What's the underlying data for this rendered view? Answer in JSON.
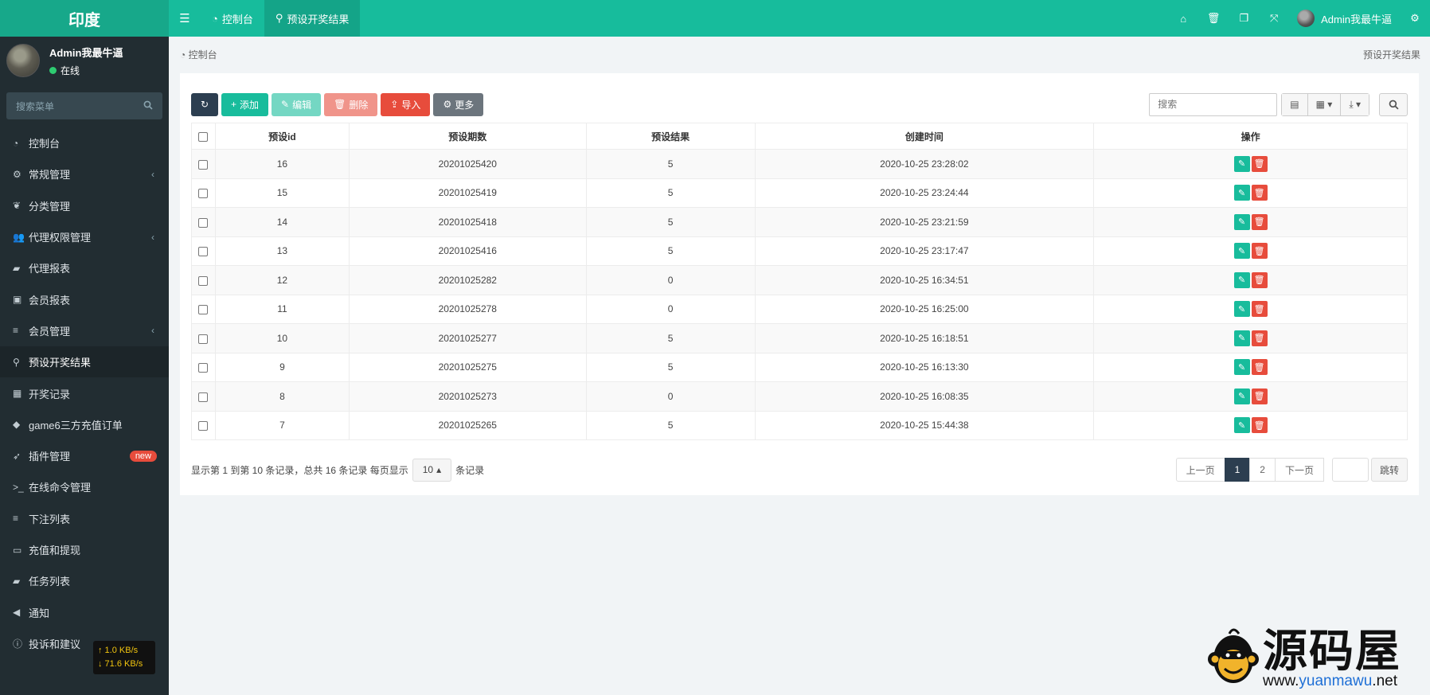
{
  "sidebar": {
    "logo": "印度",
    "user_name": "Admin我最牛逼",
    "user_status": "在线",
    "search_placeholder": "搜索菜单",
    "items": [
      {
        "label": "控制台",
        "icon": "dashboard-icon"
      },
      {
        "label": "常规管理",
        "icon": "cogs-icon",
        "has_arrow": true
      },
      {
        "label": "分类管理",
        "icon": "leaf-icon"
      },
      {
        "label": "代理权限管理",
        "icon": "group-icon",
        "has_arrow": true
      },
      {
        "label": "代理报表",
        "icon": "book-icon"
      },
      {
        "label": "会员报表",
        "icon": "contact-icon"
      },
      {
        "label": "会员管理",
        "icon": "list-icon",
        "has_arrow": true
      },
      {
        "label": "预设开奖结果",
        "icon": "magic-icon",
        "active": true
      },
      {
        "label": "开奖记录",
        "icon": "calendar-check-icon"
      },
      {
        "label": "game6三方充值订单",
        "icon": "diamond-icon"
      },
      {
        "label": "插件管理",
        "icon": "rocket-icon",
        "badge": "new"
      },
      {
        "label": "在线命令管理",
        "icon": "terminal-icon"
      },
      {
        "label": "下注列表",
        "icon": "list-icon"
      },
      {
        "label": "充值和提现",
        "icon": "money-icon"
      },
      {
        "label": "任务列表",
        "icon": "book-icon"
      },
      {
        "label": "通知",
        "icon": "bullhorn-icon"
      },
      {
        "label": "投诉和建议",
        "icon": "info-circle-icon"
      }
    ],
    "netspeed_up": "↑ 1.0 KB/s",
    "netspeed_down": "↓ 71.6 KB/s"
  },
  "topbar": {
    "tabs": [
      {
        "label": "控制台",
        "icon": "dashboard-icon"
      },
      {
        "label": "预设开奖结果",
        "icon": "magic-icon",
        "active": true
      }
    ],
    "user_name": "Admin我最牛逼"
  },
  "breadcrumb": {
    "left": "控制台",
    "right": "预设开奖结果"
  },
  "toolbar": {
    "add": "添加",
    "edit": "编辑",
    "delete": "删除",
    "import": "导入",
    "more": "更多",
    "search_placeholder": "搜索"
  },
  "table": {
    "headers": [
      "预设id",
      "预设期数",
      "预设结果",
      "创建时间",
      "操作"
    ],
    "rows": [
      [
        "16",
        "20201025420",
        "5",
        "2020-10-25 23:28:02"
      ],
      [
        "15",
        "20201025419",
        "5",
        "2020-10-25 23:24:44"
      ],
      [
        "14",
        "20201025418",
        "5",
        "2020-10-25 23:21:59"
      ],
      [
        "13",
        "20201025416",
        "5",
        "2020-10-25 23:17:47"
      ],
      [
        "12",
        "20201025282",
        "0",
        "2020-10-25 16:34:51"
      ],
      [
        "11",
        "20201025278",
        "0",
        "2020-10-25 16:25:00"
      ],
      [
        "10",
        "20201025277",
        "5",
        "2020-10-25 16:18:51"
      ],
      [
        "9",
        "20201025275",
        "5",
        "2020-10-25 16:13:30"
      ],
      [
        "8",
        "20201025273",
        "0",
        "2020-10-25 16:08:35"
      ],
      [
        "7",
        "20201025265",
        "5",
        "2020-10-25 15:44:38"
      ]
    ]
  },
  "pager": {
    "summary_prefix": "显示第 1 到第 10 条记录，总共 16 条记录 每页显示",
    "page_size": "10",
    "summary_suffix": "条记录",
    "prev": "上一页",
    "pages": [
      "1",
      "2"
    ],
    "next": "下一页",
    "go": "跳转"
  },
  "watermark": {
    "cn": "源码屋",
    "url_a": "www.",
    "url_b": "yuanmawu",
    "url_c": ".net"
  }
}
